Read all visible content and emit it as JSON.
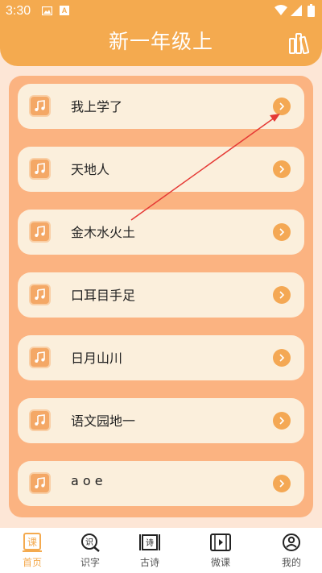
{
  "status_bar": {
    "time": "3:30",
    "badge_letter": "A"
  },
  "header": {
    "title": "新一年级上"
  },
  "lessons": [
    {
      "label": "我上学了"
    },
    {
      "label": "天地人"
    },
    {
      "label": "金木水火土"
    },
    {
      "label": "口耳目手足"
    },
    {
      "label": "日月山川"
    },
    {
      "label": "语文园地一"
    },
    {
      "label": "a o e"
    }
  ],
  "nav": [
    {
      "label": "首页",
      "icon": "lesson-icon",
      "active": true
    },
    {
      "label": "识字",
      "icon": "literacy-icon"
    },
    {
      "label": "古诗",
      "icon": "poem-icon"
    },
    {
      "label": "微课",
      "icon": "video-icon"
    },
    {
      "label": "我的",
      "icon": "profile-icon"
    }
  ],
  "colors": {
    "accent": "#f4aa4f",
    "panel": "#fbb381",
    "card": "#fbefdc",
    "annotation": "#e53935"
  }
}
